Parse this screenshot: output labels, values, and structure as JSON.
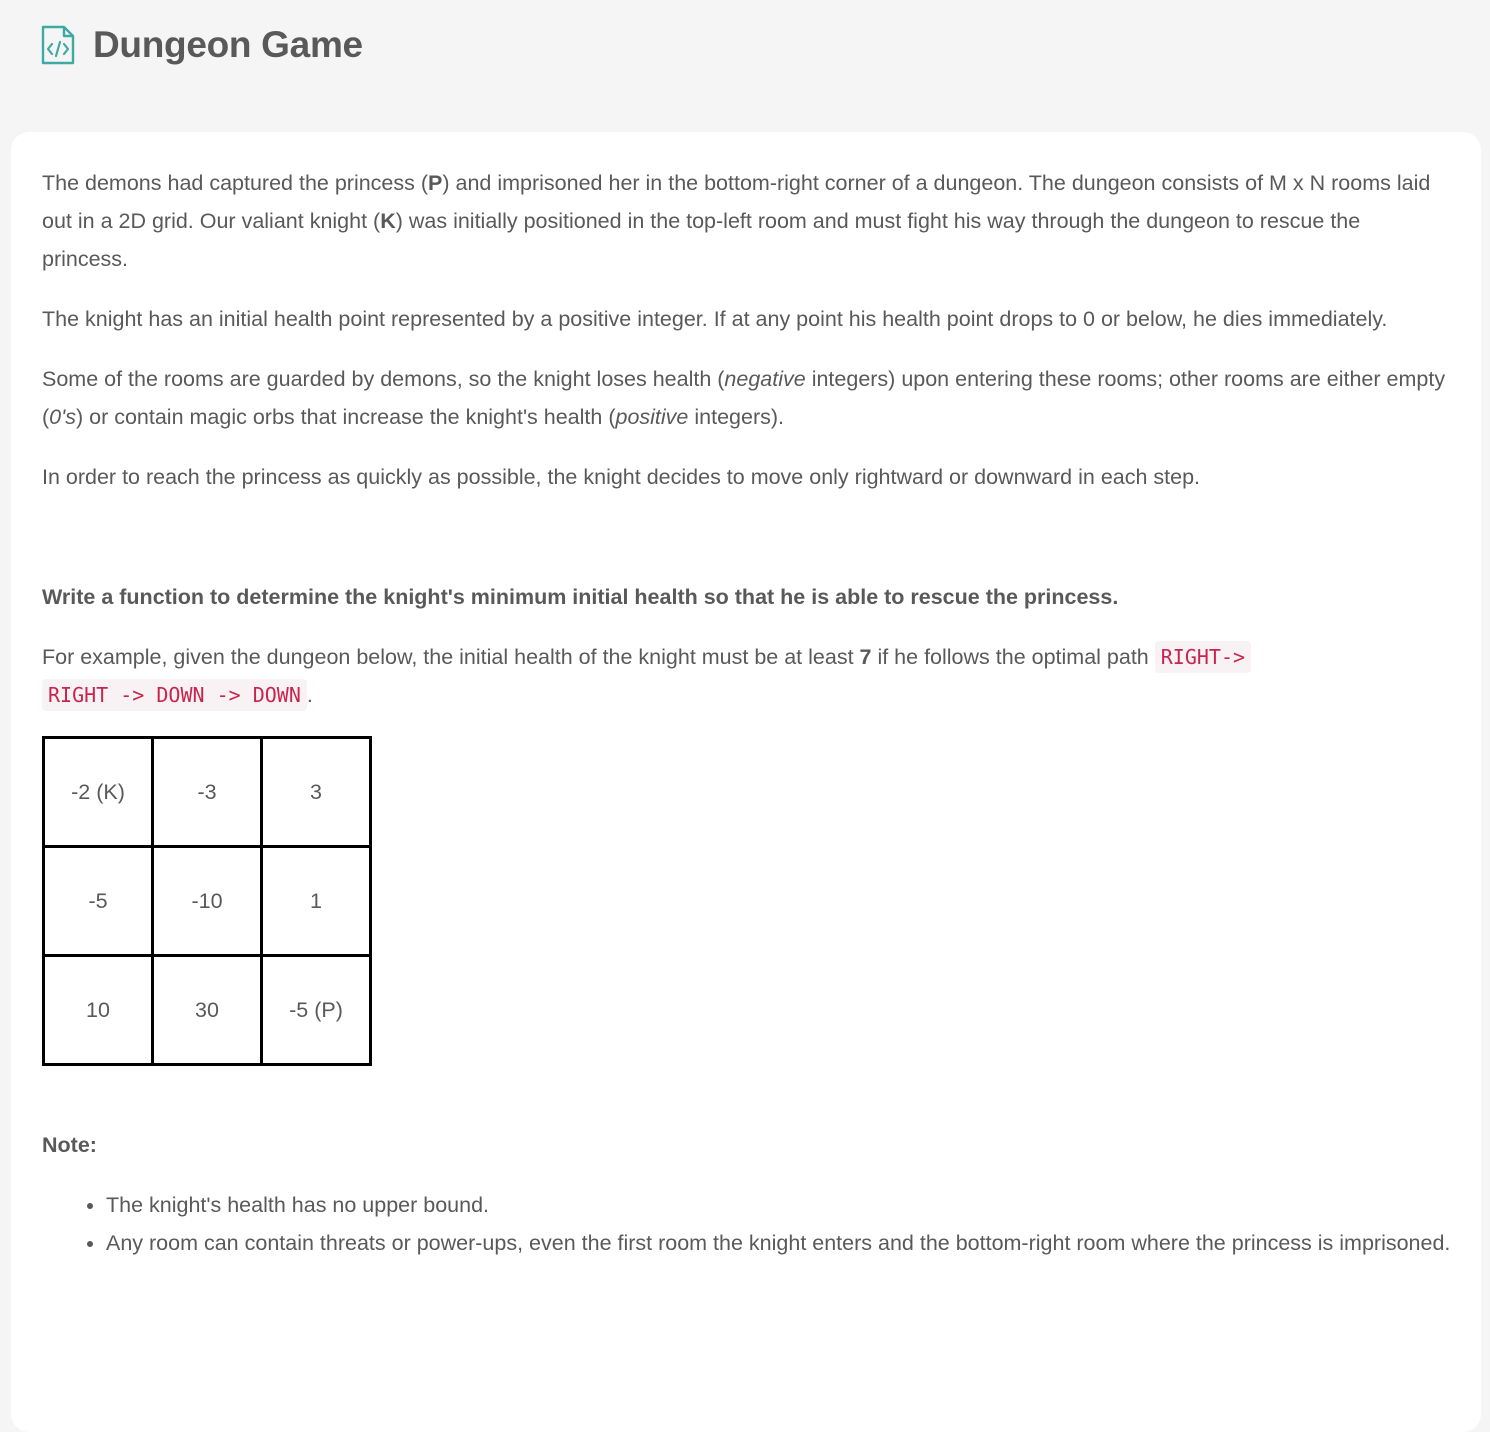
{
  "header": {
    "icon": "code-file-icon",
    "title": "Dungeon Game"
  },
  "description": {
    "p1_a": "The demons had captured the princess (",
    "p1_b": "P",
    "p1_c": ") and imprisoned her in the bottom-right corner of a dungeon. The dungeon consists of M x N rooms laid out in a 2D grid. Our valiant knight (",
    "p1_d": "K",
    "p1_e": ") was initially positioned in the top-left room and must fight his way through the dungeon to rescue the princess.",
    "p2": "The knight has an initial health point represented by a positive integer. If at any point his health point drops to 0 or below, he dies immediately.",
    "p3_a": "Some of the rooms are guarded by demons, so the knight loses health (",
    "p3_b": "negative",
    "p3_c": " integers) upon entering these rooms; other rooms are either empty (",
    "p3_d": "0's",
    "p3_e": ") or contain magic orbs that increase the knight's health (",
    "p3_f": "positive",
    "p3_g": " integers).",
    "p4": "In order to reach the princess as quickly as possible, the knight decides to move only rightward or downward in each step.",
    "task": "Write a function to determine the knight's minimum initial health so that he is able to rescue the princess.",
    "example_a": "For example, given the dungeon below, the initial health of the knight must be at least ",
    "example_b": "7",
    "example_c": " if he follows the optimal path ",
    "example_code_1": "RIGHT->",
    "example_code_2": "RIGHT -> DOWN -> DOWN",
    "example_d": "."
  },
  "dungeon": {
    "rows": [
      [
        "-2 (K)",
        "-3",
        "3"
      ],
      [
        "-5",
        "-10",
        "1"
      ],
      [
        "10",
        "30",
        "-5 (P)"
      ]
    ]
  },
  "note": {
    "label": "Note:",
    "items": [
      "The knight's health has no upper bound.",
      "Any room can contain threats or power-ups, even the first room the knight enters and the bottom-right room where the princess is imprisoned."
    ]
  },
  "colors": {
    "background": "#f5f5f5",
    "card": "#ffffff",
    "text": "#595959",
    "code_text": "#c7254e",
    "code_bg": "#f9f2f4",
    "icon": "#3fa9a5"
  }
}
